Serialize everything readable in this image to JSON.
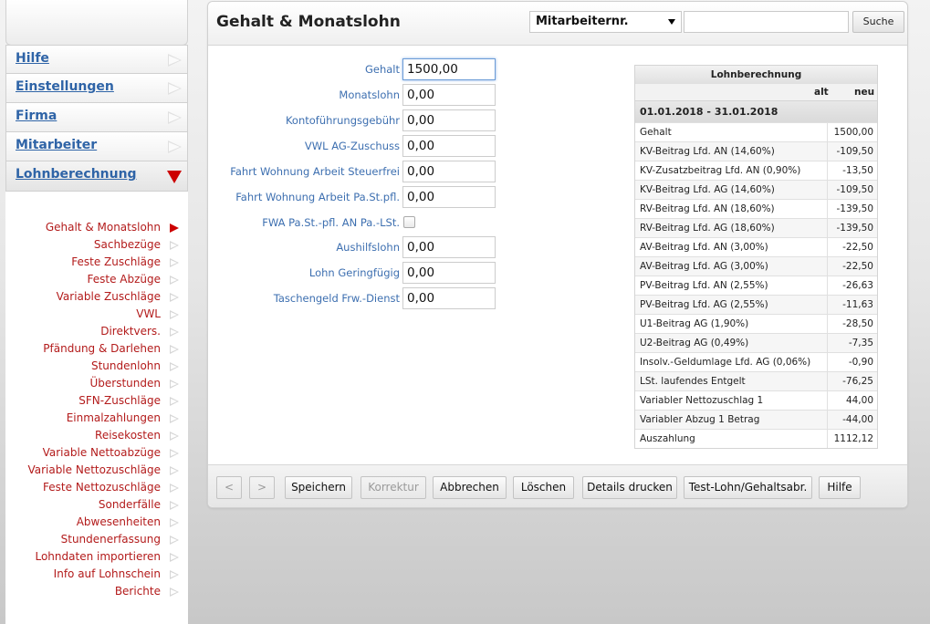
{
  "sidebar": {
    "main_items": [
      {
        "label": "Hilfe"
      },
      {
        "label": "Einstellungen"
      },
      {
        "label": "Firma"
      },
      {
        "label": "Mitarbeiter"
      },
      {
        "label": "Lohnberechnung",
        "active": true
      }
    ],
    "sub_items": [
      {
        "label": "Gehalt & Monatslohn",
        "active": true
      },
      {
        "label": "Sachbezüge"
      },
      {
        "label": "Feste Zuschläge"
      },
      {
        "label": "Feste Abzüge"
      },
      {
        "label": "Variable Zuschläge"
      },
      {
        "label": "VWL"
      },
      {
        "label": "Direktvers."
      },
      {
        "label": "Pfändung & Darlehen"
      },
      {
        "label": "Stundenlohn"
      },
      {
        "label": "Überstunden"
      },
      {
        "label": "SFN-Zuschläge"
      },
      {
        "label": "Einmalzahlungen"
      },
      {
        "label": "Reisekosten"
      },
      {
        "label": "Variable Nettoabzüge"
      },
      {
        "label": "Variable Nettozuschläge"
      },
      {
        "label": "Feste Nettozuschläge"
      },
      {
        "label": "Sonderfälle"
      },
      {
        "label": "Abwesenheiten"
      },
      {
        "label": "Stundenerfassung"
      },
      {
        "label": "Lohndaten importieren"
      },
      {
        "label": "Info auf Lohnschein"
      },
      {
        "label": "Berichte"
      }
    ]
  },
  "header": {
    "title": "Gehalt & Monatslohn",
    "employee_select": "Mitarbeiternr.",
    "search_value": "",
    "search_label": "Suche"
  },
  "form": {
    "fields": [
      {
        "label": "Gehalt",
        "value": "1500,00",
        "type": "input",
        "focused": true
      },
      {
        "label": "Monatslohn",
        "value": "0,00",
        "type": "input"
      },
      {
        "label": "Kontoführungsgebühr",
        "value": "0,00",
        "type": "input"
      },
      {
        "label": "VWL AG-Zuschuss",
        "value": "0,00",
        "type": "input"
      },
      {
        "label": "Fahrt Wohnung Arbeit Steuerfrei",
        "value": "0,00",
        "type": "input"
      },
      {
        "label": "Fahrt Wohnung Arbeit Pa.St.pfl.",
        "value": "0,00",
        "type": "input"
      },
      {
        "label": "FWA Pa.St.-pfl. AN Pa.-LSt.",
        "value": "",
        "type": "checkbox",
        "checked": false
      },
      {
        "label": "Aushilfslohn",
        "value": "0,00",
        "type": "input"
      },
      {
        "label": "Lohn Geringfügig",
        "value": "0,00",
        "type": "input"
      },
      {
        "label": "Taschengeld Frw.-Dienst",
        "value": "0,00",
        "type": "input"
      }
    ]
  },
  "calc": {
    "title": "Lohnberechnung",
    "col_old": "alt",
    "col_new": "neu",
    "period": "01.01.2018 - 31.01.2018",
    "rows": [
      {
        "label": "Gehalt",
        "value": "1500,00"
      },
      {
        "label": "KV-Beitrag Lfd. AN (14,60%)",
        "value": "-109,50"
      },
      {
        "label": "KV-Zusatzbeitrag Lfd. AN (0,90%)",
        "value": "-13,50"
      },
      {
        "label": "KV-Beitrag Lfd. AG (14,60%)",
        "value": "-109,50"
      },
      {
        "label": "RV-Beitrag Lfd. AN (18,60%)",
        "value": "-139,50"
      },
      {
        "label": "RV-Beitrag Lfd. AG (18,60%)",
        "value": "-139,50"
      },
      {
        "label": "AV-Beitrag Lfd. AN (3,00%)",
        "value": "-22,50"
      },
      {
        "label": "AV-Beitrag Lfd. AG (3,00%)",
        "value": "-22,50"
      },
      {
        "label": "PV-Beitrag Lfd. AN (2,55%)",
        "value": "-26,63"
      },
      {
        "label": "PV-Beitrag Lfd. AG (2,55%)",
        "value": "-11,63"
      },
      {
        "label": "U1-Beitrag AG (1,90%)",
        "value": "-28,50"
      },
      {
        "label": "U2-Beitrag AG (0,49%)",
        "value": "-7,35"
      },
      {
        "label": "Insolv.-Geldumlage Lfd. AG (0,06%)",
        "value": "-0,90"
      },
      {
        "label": "LSt. laufendes Entgelt",
        "value": "-76,25"
      },
      {
        "label": "Variabler Nettozuschlag 1",
        "value": "44,00"
      },
      {
        "label": "Variabler Abzug 1 Betrag",
        "value": "-44,00"
      },
      {
        "label": "Auszahlung",
        "value": "1112,12"
      }
    ]
  },
  "toolbar": {
    "prev": "<",
    "next": ">",
    "save": "Speichern",
    "correct": "Korrektur",
    "cancel": "Abbrechen",
    "delete": "Löschen",
    "print_details": "Details drucken",
    "test_payslip": "Test-Lohn/Gehaltsabr.",
    "help": "Hilfe"
  }
}
